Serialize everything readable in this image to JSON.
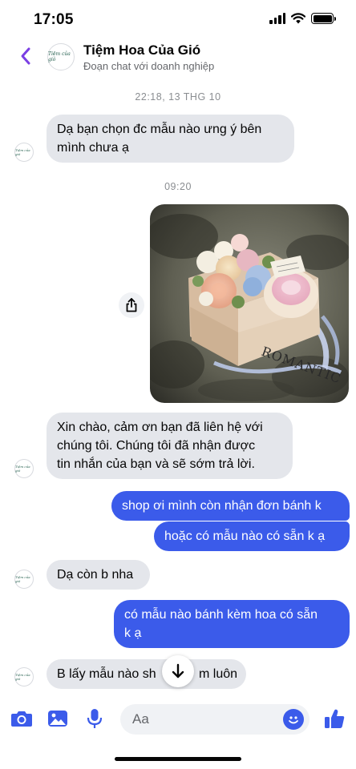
{
  "status_bar": {
    "time": "17:05"
  },
  "header": {
    "title": "Tiệm Hoa Của Gió",
    "subtitle": "Đoạn chat với doanh nghiệp",
    "avatar_text": "Tiệm của gió"
  },
  "messages": {
    "timestamp_1": "22:18, 13 THG 10",
    "shop_msg_1": [
      "Dạ bạn chọn đc mẫu nào ưng ý bên",
      "mình chưa ạ"
    ],
    "timestamp_2": "09:20",
    "photo_box_text": "ROMANTIC",
    "auto_reply": [
      "Xin chào, cảm ơn bạn đã liên hệ với",
      "chúng tôi. Chúng tôi đã nhận được",
      "tin nhắn của bạn và sẽ sớm trả lời."
    ],
    "user_msg_1": "shop ơi mình còn nhận đơn bánh k",
    "user_msg_2": "hoặc có mẫu nào có sẵn k ạ",
    "shop_msg_2": "Dạ còn b nha",
    "user_msg_3": [
      "có mẫu nào bánh kèm hoa có sẵn",
      "k ạ"
    ],
    "shop_msg_3_left": "B lấy mẫu nào sh",
    "shop_msg_3_right": "m luôn"
  },
  "composer": {
    "placeholder": "Aa"
  },
  "colors": {
    "accent": "#3b5bea",
    "incoming_bubble": "#e4e6eb",
    "back_chevron": "#7b3fe4",
    "like": "#3b5bea"
  },
  "icons": {
    "back": "chevron-left-icon",
    "share": "share-icon",
    "scroll": "arrow-down-icon",
    "camera": "camera-icon",
    "gallery": "image-icon",
    "mic": "microphone-icon",
    "emoji": "emoji-icon",
    "like": "thumbs-up-icon"
  }
}
